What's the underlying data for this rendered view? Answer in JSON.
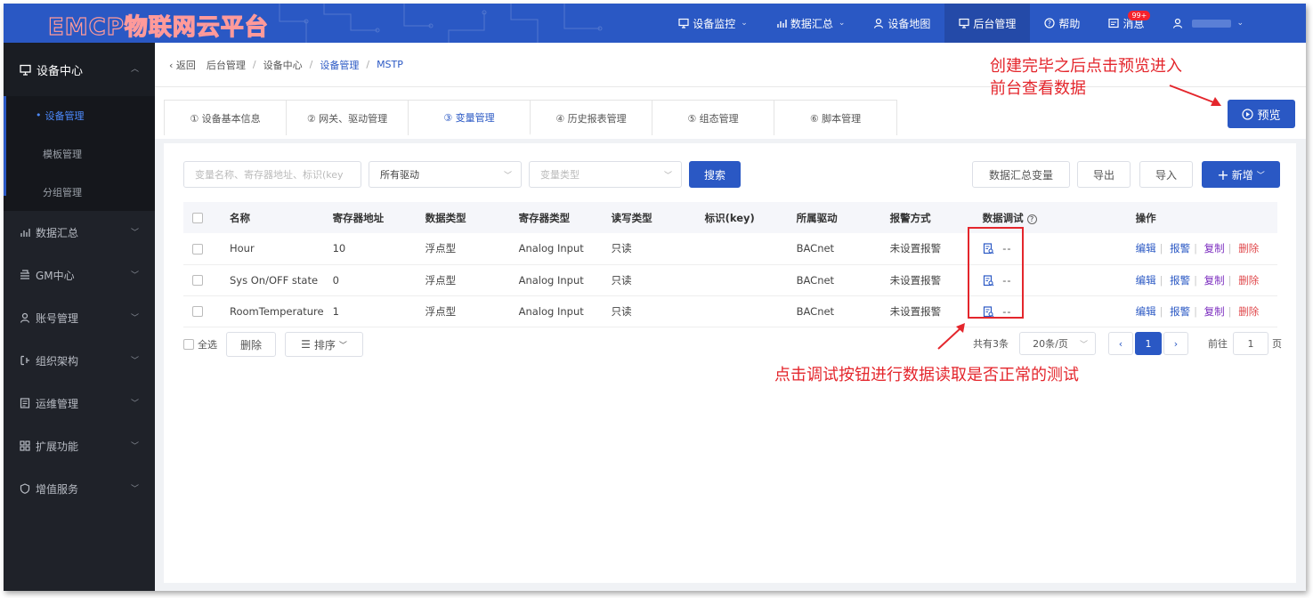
{
  "header": {
    "logo": "EMCP物联网云平台",
    "nav": [
      {
        "label": "设备监控",
        "icon": "monitor-icon",
        "caret": true
      },
      {
        "label": "数据汇总",
        "icon": "chart-icon",
        "caret": true
      },
      {
        "label": "设备地图",
        "icon": "user-pin-icon",
        "caret": false
      },
      {
        "label": "后台管理",
        "icon": "monitor-icon",
        "caret": false,
        "active": true
      },
      {
        "label": "帮助",
        "icon": "help-icon",
        "caret": false
      },
      {
        "label": "消息",
        "icon": "message-icon",
        "caret": false,
        "badge": "99+"
      }
    ]
  },
  "sidebar": {
    "device_center": "设备中心",
    "sub_items": [
      "设备管理",
      "模板管理",
      "分组管理"
    ],
    "groups": [
      "数据汇总",
      "GM中心",
      "账号管理",
      "组织架构",
      "运维管理",
      "扩展功能",
      "增值服务"
    ]
  },
  "breadcrumb": {
    "back": "返回",
    "items": [
      "后台管理",
      "设备中心",
      "设备管理",
      "MSTP"
    ]
  },
  "tabs": [
    "① 设备基本信息",
    "② 网关、驱动管理",
    "③ 变量管理",
    "④ 历史报表管理",
    "⑤ 组态管理",
    "⑥ 脚本管理"
  ],
  "preview_label": "预览",
  "filters": {
    "search_placeholder": "变量名称、寄存器地址、标识(key",
    "driver_value": "所有驱动",
    "type_placeholder": "变量类型",
    "search_button": "搜索"
  },
  "actions": {
    "summary": "数据汇总变量",
    "export": "导出",
    "import": "导入",
    "add": "新增"
  },
  "table": {
    "headers": [
      "名称",
      "寄存器地址",
      "数据类型",
      "寄存器类型",
      "读写类型",
      "标识(key)",
      "所属驱动",
      "报警方式",
      "数据调试",
      "操作"
    ],
    "rows": [
      {
        "name": "Hour",
        "addr": "10",
        "dtype": "浮点型",
        "rtype": "Analog Input",
        "rw": "只读",
        "key": "",
        "driver": "BACnet",
        "alarm": "未设置报警",
        "debug": "--"
      },
      {
        "name": "Sys On/OFF state",
        "addr": "0",
        "dtype": "浮点型",
        "rtype": "Analog Input",
        "rw": "只读",
        "key": "",
        "driver": "BACnet",
        "alarm": "未设置报警",
        "debug": "--"
      },
      {
        "name": "RoomTemperature",
        "addr": "1",
        "dtype": "浮点型",
        "rtype": "Analog Input",
        "rw": "只读",
        "key": "",
        "driver": "BACnet",
        "alarm": "未设置报警",
        "debug": "--"
      }
    ],
    "ops": {
      "edit": "编辑",
      "alarm": "报警",
      "copy": "复制",
      "delete": "删除"
    }
  },
  "footer": {
    "select_all": "全选",
    "delete": "删除",
    "sort": "排序",
    "total": "共有3条",
    "page_size": "20条/页",
    "current_page": "1",
    "goto_label": "前往",
    "goto_value": "1",
    "page_unit": "页"
  },
  "annotations": {
    "preview_line1": "创建完毕之后点击预览进入",
    "preview_line2": "前台查看数据",
    "debug_note": "点击调试按钮进行数据读取是否正常的测试"
  },
  "colors": {
    "primary": "#2a58c4",
    "sidebar": "#1f2229",
    "annotation": "#e4262c"
  }
}
